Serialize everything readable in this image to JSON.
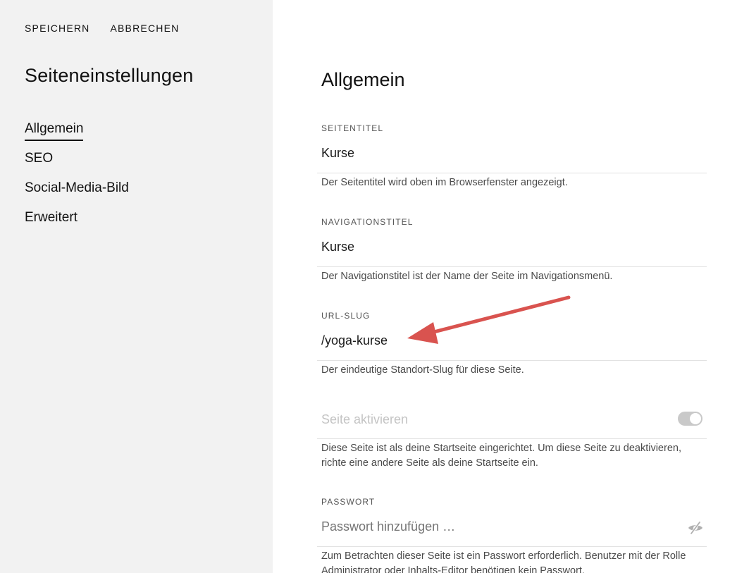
{
  "toolbar": {
    "save_label": "SPEICHERN",
    "cancel_label": "ABBRECHEN"
  },
  "sidebar": {
    "title": "Seiteneinstellungen",
    "items": [
      {
        "label": "Allgemein",
        "active": true
      },
      {
        "label": "SEO",
        "active": false
      },
      {
        "label": "Social-Media-Bild",
        "active": false
      },
      {
        "label": "Erweitert",
        "active": false
      }
    ]
  },
  "main": {
    "title": "Allgemein",
    "page_title": {
      "label": "SEITENTITEL",
      "value": "Kurse",
      "help": "Der Seitentitel wird oben im Browserfenster angezeigt."
    },
    "nav_title": {
      "label": "NAVIGATIONSTITEL",
      "value": "Kurse",
      "help": "Der Navigationstitel ist der Name der Seite im Navigationsmenü."
    },
    "url_slug": {
      "label": "URL-SLUG",
      "value": "/yoga-kurse",
      "help": "Der eindeutige Standort-Slug für diese Seite."
    },
    "enable_page": {
      "label": "Seite aktivieren",
      "enabled": true,
      "disabled_state": true,
      "help": "Diese Seite ist als deine Startseite eingerichtet. Um diese Seite zu deaktivieren, richte eine andere Seite als deine Startseite ein."
    },
    "password": {
      "label": "PASSWORT",
      "value": "",
      "placeholder": "Passwort hinzufügen …",
      "icon": "eye-off-icon",
      "help": "Zum Betrachten dieser Seite ist ein Passwort erforderlich. Benutzer mit der Rolle Administrator oder Inhalts-Editor benötigen kein Passwort."
    }
  },
  "colors": {
    "sidebar_bg": "#f2f2f2",
    "annotation_arrow": "#d9534f",
    "toggle_bg": "#c9c9c9"
  }
}
